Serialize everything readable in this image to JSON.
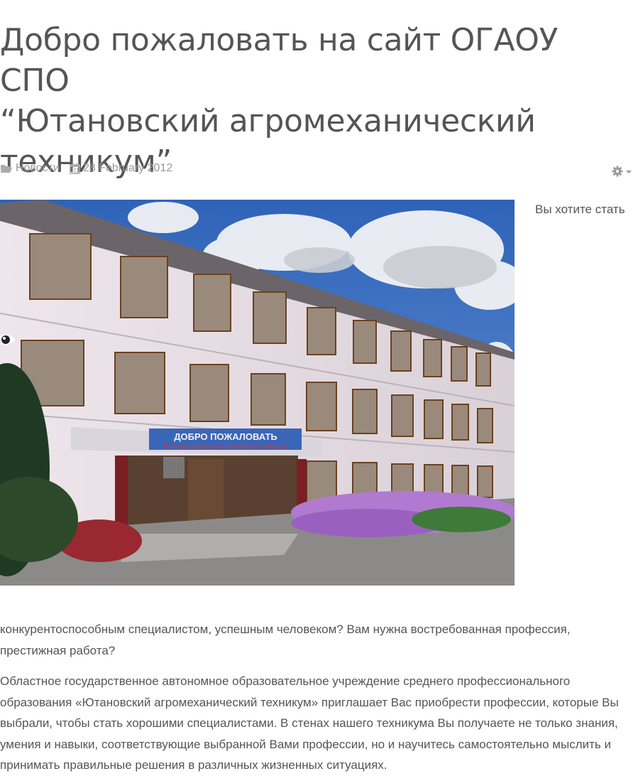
{
  "article": {
    "title_lines": [
      "Добро пожаловать на сайт ОГАОУ СПО",
      "“Ютановский агромеханический",
      "техникум”"
    ],
    "category": "Новости",
    "date": "28 February 2012",
    "intro_start": "Вы хотите стать",
    "paragraph_1": "конкурентоспособным специалистом, успешным человеком? Вам нужна востребованная профессия, престижная работа?",
    "paragraph_2": "Областное государственное автономное образовательное учреждение среднего профессионального образования «Ютановский агромеханический техникум» приглашает Вас приобрести профессии, которые Вы выбрали, чтобы стать хорошими специалистами. В стенах нашего техникума Вы получаете не только знания, умения и навыки, соответствующие выбранной Вами профессии, но и научитесь самостоятельно мыслить и принимать правильные решения в различных жизненных ситуациях."
  },
  "photo": {
    "banner_line1": "ДОБРО ПОЖАЛОВАТЬ",
    "banner_line2": "Ютановское профессиональное училище"
  },
  "icons": {
    "category": "folder-open-icon",
    "date": "calendar-icon",
    "tools": "gear-icon",
    "hits": "eye-icon"
  },
  "colors": {
    "text": "#555555",
    "meta": "#999999",
    "sky": "#3a6fc2"
  }
}
